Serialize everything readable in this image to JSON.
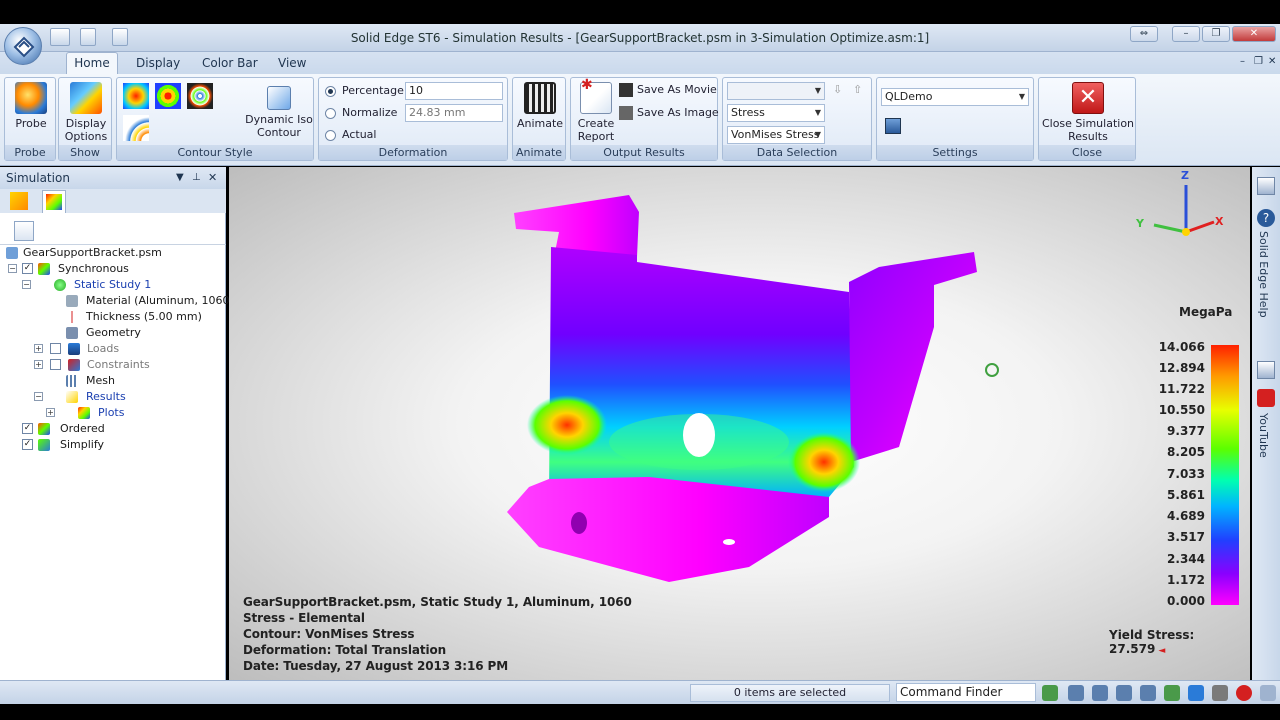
{
  "window": {
    "title": "Solid Edge ST6 - Simulation Results - [GearSupportBracket.psm in 3-Simulation Optimize.asm:1]"
  },
  "menu_tabs": [
    "Home",
    "Display",
    "Color Bar",
    "View"
  ],
  "ribbon": {
    "probe": {
      "button": "Probe",
      "group": "Probe"
    },
    "show": {
      "button_line1": "Display",
      "button_line2": "Options",
      "group": "Show"
    },
    "contour": {
      "iso_line1": "Dynamic Iso",
      "iso_line2": "Contour",
      "group": "Contour Style"
    },
    "deformation": {
      "percentage_label": "Percentage",
      "percentage_value": "10",
      "normalize_label": "Normalize",
      "normalize_value": "24.83 mm",
      "actual_label": "Actual",
      "group": "Deformation"
    },
    "animate": {
      "button": "Animate",
      "group": "Animate"
    },
    "output": {
      "report_line1": "Create",
      "report_line2": "Report",
      "save_movie": "Save As Movie",
      "save_image": "Save As Image",
      "group": "Output Results"
    },
    "data_selection": {
      "top_combo": "",
      "stress_combo": "Stress",
      "vonmises_combo": "VonMises Stress",
      "group": "Data Selection"
    },
    "settings": {
      "combo": "QLDemo",
      "group": "Settings"
    },
    "close": {
      "line1": "Close Simulation",
      "line2": "Results",
      "group": "Close"
    }
  },
  "pane": {
    "title": "Simulation",
    "tree": [
      {
        "label": "GearSupportBracket.psm"
      },
      {
        "label": "Synchronous"
      },
      {
        "label": "Static Study 1"
      },
      {
        "label": "Material (Aluminum, 1060)"
      },
      {
        "label": "Thickness (5.00 mm)"
      },
      {
        "label": "Geometry"
      },
      {
        "label": "Loads"
      },
      {
        "label": "Constraints"
      },
      {
        "label": "Mesh"
      },
      {
        "label": "Results"
      },
      {
        "label": "Plots"
      },
      {
        "label": "Ordered"
      },
      {
        "label": "Simplify"
      }
    ]
  },
  "viewport": {
    "info_lines": [
      "GearSupportBracket.psm, Static Study 1, Aluminum, 1060",
      "Stress - Elemental",
      "Contour: VonMises Stress",
      "Deformation: Total Translation",
      "Date: Tuesday, 27 August 2013  3:16 PM"
    ],
    "legend_units": "MegaPa",
    "legend_values": [
      "14.066",
      "12.894",
      "11.722",
      "10.550",
      "9.377",
      "8.205",
      "7.033",
      "5.861",
      "4.689",
      "3.517",
      "2.344",
      "1.172",
      "0.000"
    ],
    "yield_stress": "Yield Stress: 27.579",
    "triad": {
      "z": "Z",
      "y": "Y",
      "x": "X"
    }
  },
  "right_tabs": [
    "Solid Edge Help",
    "YouTube"
  ],
  "status": {
    "message": "0 items are selected",
    "command_finder": "Command Finder"
  },
  "colors": {
    "accent": "#1f3550",
    "close_red": "#d42020"
  }
}
